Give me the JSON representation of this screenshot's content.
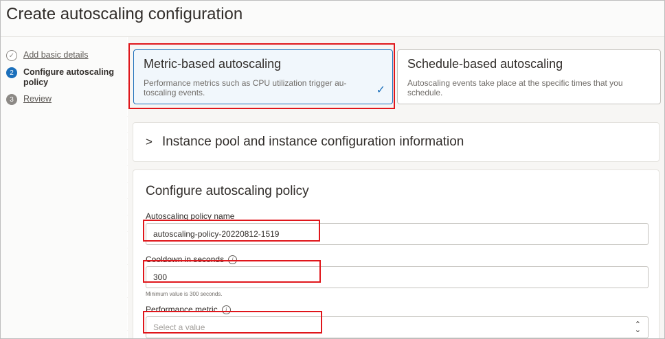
{
  "page": {
    "title": "Create autoscaling configuration"
  },
  "steps": [
    {
      "number": "✓",
      "label": "Add basic details",
      "state": "done"
    },
    {
      "number": "2",
      "label": "Configure autoscaling policy",
      "state": "active"
    },
    {
      "number": "3",
      "label": "Review",
      "state": "pending"
    }
  ],
  "tiles": {
    "metric": {
      "title": "Metric-based autoscaling",
      "description": "Performance metrics such as CPU utilization trigger au-toscaling events.",
      "selected": true
    },
    "schedule": {
      "title": "Schedule-based autoscaling",
      "description": "Autoscaling events take place at the specific times that you schedule.",
      "selected": false
    }
  },
  "expander": {
    "label": "Instance pool and instance configuration information"
  },
  "policy": {
    "title": "Configure autoscaling policy",
    "name_label": "Autoscaling policy name",
    "name_value": "autoscaling-policy-20220812-1519",
    "cooldown_label": "Cooldown in seconds",
    "cooldown_value": "300",
    "cooldown_hint": "Minimum value is 300 seconds.",
    "metric_label": "Performance metric",
    "metric_placeholder": "Select a value"
  },
  "colors": {
    "accent": "#1b6fbb",
    "highlight": "#e0161b"
  }
}
